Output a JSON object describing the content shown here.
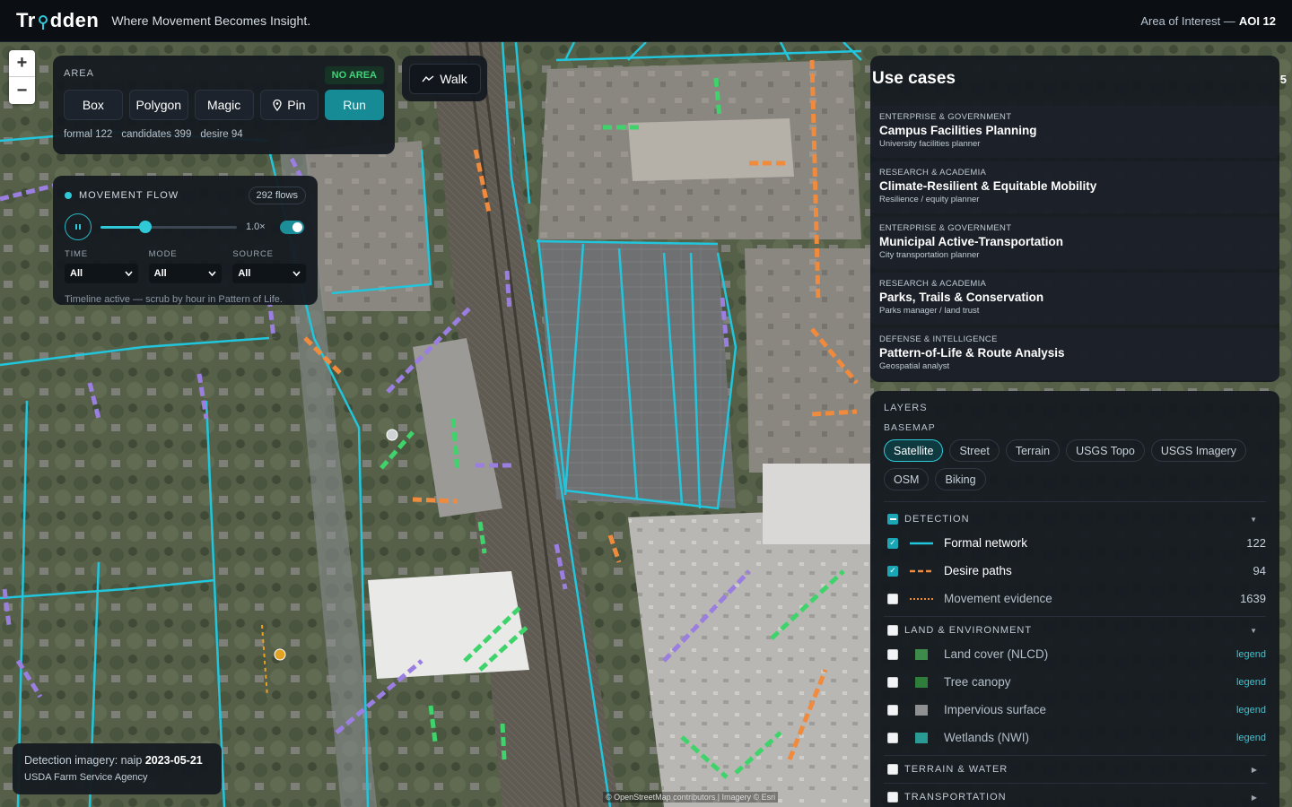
{
  "header": {
    "logo_text": "Trodden",
    "tagline": "Where Movement Becomes Insight.",
    "aoi_label": "Area of Interest —",
    "aoi_value": "AOI 12"
  },
  "zoom": {
    "in": "+",
    "out": "−"
  },
  "area": {
    "label": "AREA",
    "badge": "NO AREA",
    "tools": [
      "Box",
      "Polygon",
      "Magic",
      "Pin"
    ],
    "run": "Run",
    "counts": [
      "formal 122",
      "candidates 399",
      "desire 94"
    ]
  },
  "walk": {
    "label": "Walk"
  },
  "flow": {
    "label": "MOVEMENT FLOW",
    "count": "292 flows",
    "progress": 0.33,
    "speed": "1.0×",
    "filters": [
      {
        "label": "TIME",
        "value": "All"
      },
      {
        "label": "MODE",
        "value": "All"
      },
      {
        "label": "SOURCE",
        "value": "All"
      }
    ],
    "hint": "Timeline active — scrub by hour in Pattern of Life."
  },
  "imagery": {
    "prefix": "Detection imagery: naip",
    "date": "2023-05-21",
    "source": "USDA Farm Service Agency"
  },
  "attribution": "© OpenStreetMap contributors | Imagery © Esri",
  "usecases": {
    "title": "Use cases",
    "count": "5",
    "items": [
      {
        "category": "ENTERPRISE & GOVERNMENT",
        "name": "Campus Facilities Planning",
        "sub": "University facilities planner"
      },
      {
        "category": "RESEARCH & ACADEMIA",
        "name": "Climate-Resilient & Equitable Mobility",
        "sub": "Resilience / equity planner"
      },
      {
        "category": "ENTERPRISE & GOVERNMENT",
        "name": "Municipal Active-Transportation",
        "sub": "City transportation planner"
      },
      {
        "category": "RESEARCH & ACADEMIA",
        "name": "Parks, Trails & Conservation",
        "sub": "Parks manager / land trust"
      },
      {
        "category": "DEFENSE & INTELLIGENCE",
        "name": "Pattern-of-Life & Route Analysis",
        "sub": "Geospatial analyst"
      }
    ]
  },
  "layers": {
    "title": "LAYERS",
    "basemap_label": "BASEMAP",
    "basemaps": [
      "Satellite",
      "Street",
      "Terrain",
      "USGS Topo",
      "USGS Imagery",
      "OSM",
      "Biking"
    ],
    "detection": {
      "label": "DETECTION",
      "rows": [
        {
          "name": "Formal network",
          "count": "122"
        },
        {
          "name": "Desire paths",
          "count": "94"
        },
        {
          "name": "Movement evidence",
          "count": "1639"
        }
      ]
    },
    "land": {
      "label": "LAND & ENVIRONMENT",
      "rows": [
        {
          "name": "Land cover (NLCD)",
          "link": "legend"
        },
        {
          "name": "Tree canopy",
          "link": "legend"
        },
        {
          "name": "Impervious surface",
          "link": "legend"
        },
        {
          "name": "Wetlands (NWI)",
          "link": "legend"
        }
      ]
    },
    "terrain_label": "TERRAIN & WATER",
    "transport_label": "TRANSPORTATION"
  },
  "colors": {
    "accent": "#2fc9d8",
    "formal": "#22c6dc",
    "desire": "#f08a3c",
    "green_flow": "#3fd46b",
    "purple_flow": "#9a7ee0"
  }
}
